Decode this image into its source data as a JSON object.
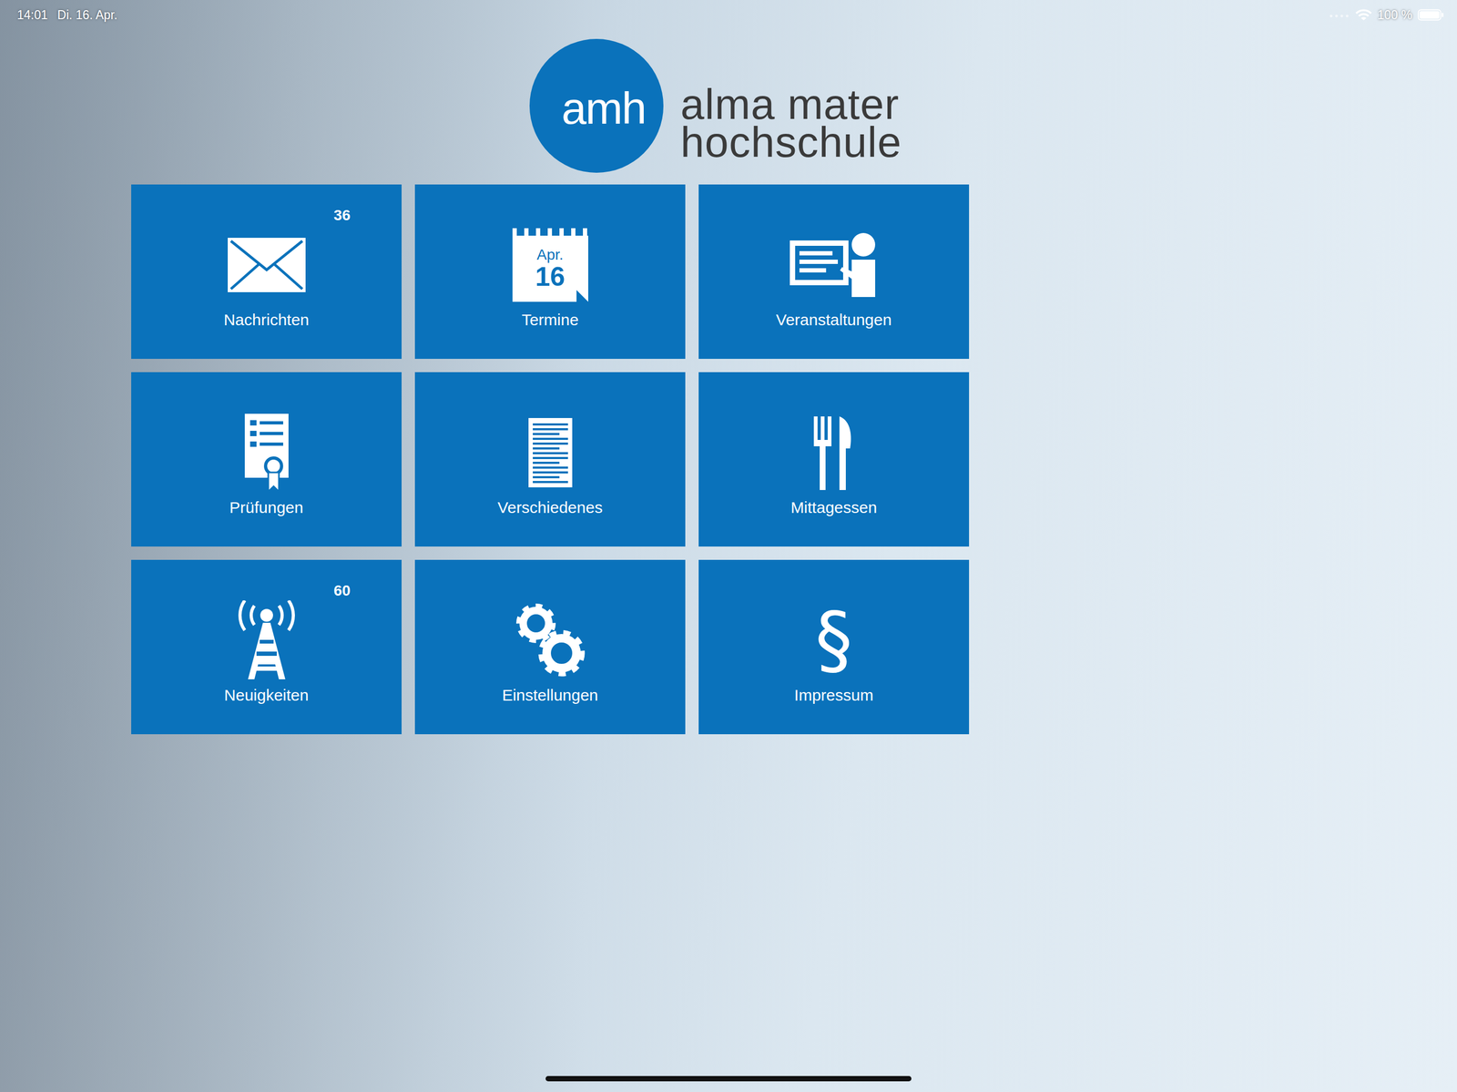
{
  "status_bar": {
    "time": "14:01",
    "date": "Di. 16. Apr.",
    "battery": "100 %",
    "battery_level": 1
  },
  "logo": {
    "mark": "amh",
    "line1": "alma mater",
    "line2": "hochschule"
  },
  "tiles": [
    {
      "label": "Nachrichten",
      "badge": "36",
      "kind": "mail"
    },
    {
      "label": "Termine",
      "kind": "calendar",
      "month": "Apr.",
      "day": "16"
    },
    {
      "label": "Veranstaltungen",
      "kind": "lecture"
    },
    {
      "label": "Prüfungen",
      "kind": "exam"
    },
    {
      "label": "Verschiedenes",
      "kind": "document"
    },
    {
      "label": "Mittagessen",
      "kind": "cutlery"
    },
    {
      "label": "Neuigkeiten",
      "badge": "60",
      "kind": "antenna"
    },
    {
      "label": "Einstellungen",
      "kind": "gears"
    },
    {
      "label": "Impressum",
      "kind": "paragraph",
      "glyph": "§"
    }
  ]
}
